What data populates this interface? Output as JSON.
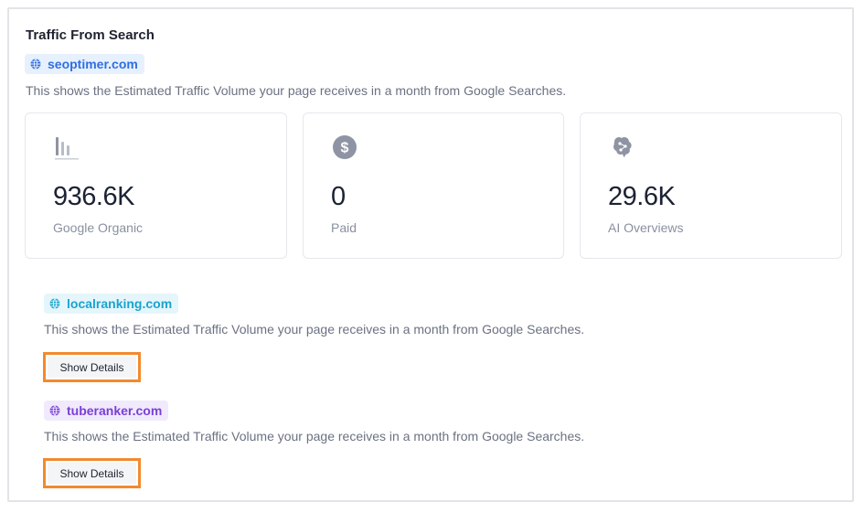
{
  "section": {
    "title": "Traffic From Search"
  },
  "primary": {
    "domain": "seoptimer.com",
    "description": "This shows the Estimated Traffic Volume your page receives in a month from Google Searches.",
    "color": "#2f6fe0"
  },
  "metrics": [
    {
      "icon": "bar-chart-icon",
      "value": "936.6K",
      "label": "Google Organic"
    },
    {
      "icon": "dollar-icon",
      "value": "0",
      "label": "Paid"
    },
    {
      "icon": "ai-brain-icon",
      "value": "29.6K",
      "label": "AI Overviews"
    }
  ],
  "competitors": [
    {
      "domain": "localranking.com",
      "description": "This shows the Estimated Traffic Volume your page receives in a month from Google Searches.",
      "button_label": "Show Details",
      "color": "#1aa3cf"
    },
    {
      "domain": "tuberanker.com",
      "description": "This shows the Estimated Traffic Volume your page receives in a month from Google Searches.",
      "button_label": "Show Details",
      "color": "#7a3fd6"
    }
  ],
  "colors": {
    "highlight_border": "#f28a2e",
    "icon_gray": "#8e94a3"
  }
}
